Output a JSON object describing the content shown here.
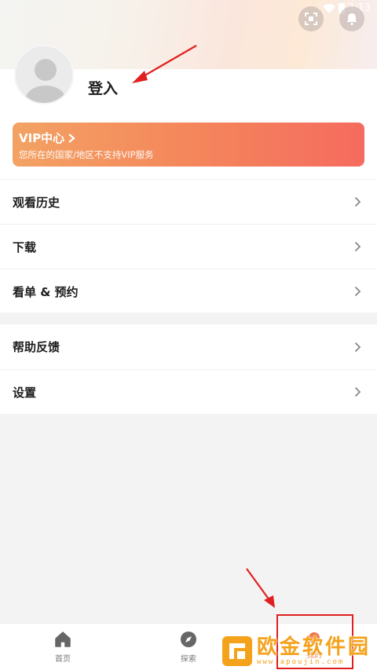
{
  "status_bar": {
    "time": "3:13"
  },
  "profile": {
    "login_label": "登入"
  },
  "vip": {
    "title": "VIP中心",
    "subtitle": "您所在的国家/地区不支持VIP服务"
  },
  "menu_group_1": [
    {
      "label": "观看历史"
    },
    {
      "label": "下载"
    },
    {
      "label": "看单 & 预约"
    }
  ],
  "menu_group_2": [
    {
      "label": "帮助反馈"
    },
    {
      "label": "设置"
    }
  ],
  "tabbar": {
    "home_label": "首页",
    "explore_label": "探索",
    "mine_label": "我的"
  },
  "watermark": {
    "name": "欧金软件园",
    "url": "www.apoujin.com"
  },
  "colors": {
    "accent": "#f0784a",
    "vip_gradient_start": "#f3a264",
    "vip_gradient_end": "#f56b5f",
    "annotation_red": "#e02020"
  },
  "icons": [
    "scan-icon",
    "bell-icon",
    "chevron-right-icon",
    "home-icon",
    "compass-icon",
    "user-icon"
  ]
}
